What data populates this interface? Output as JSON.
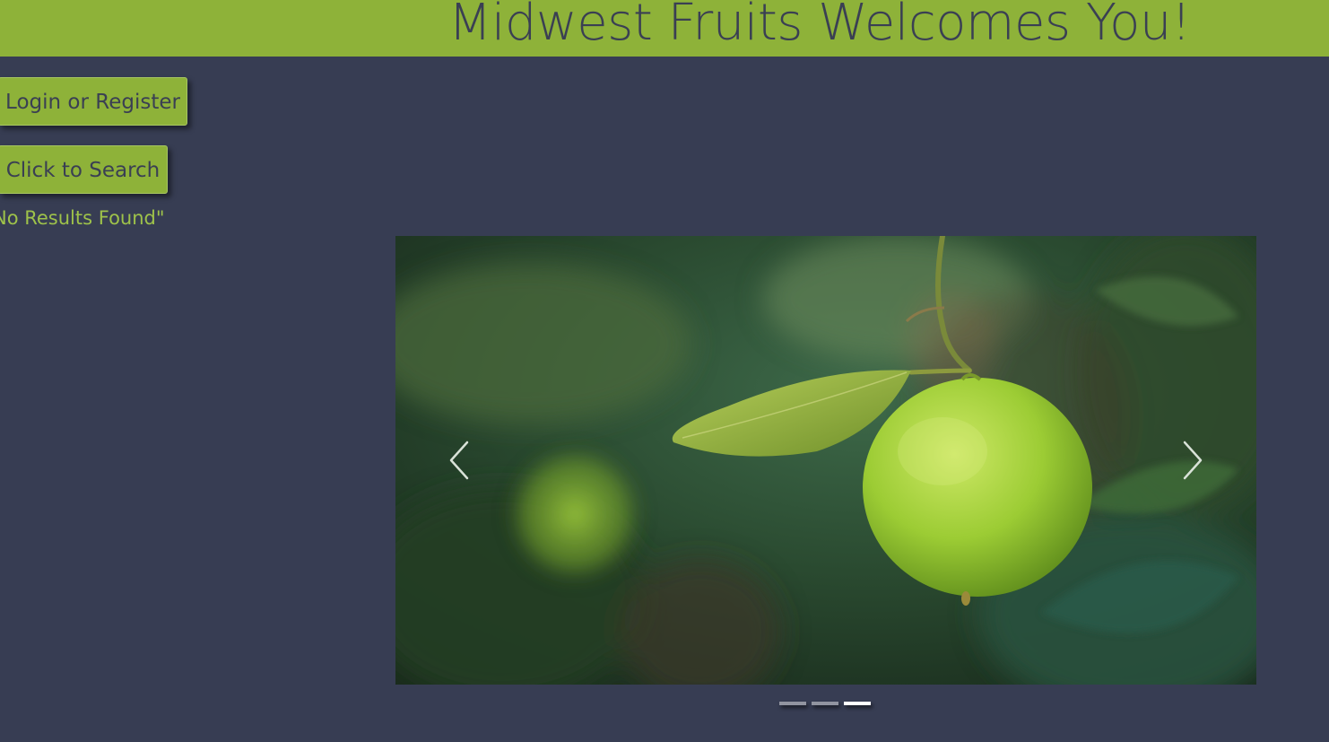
{
  "header": {
    "title": "Midwest Fruits Welcomes You!",
    "background_color": "#8eb239",
    "text_color": "#3a3f53"
  },
  "actions": {
    "login_label": "Login or Register",
    "search_label": "Click to Search"
  },
  "status": {
    "text": "No Results Found\""
  },
  "carousel": {
    "slide_image": "lime-on-tree-photo",
    "prev_icon": "chevron-left-icon",
    "next_icon": "chevron-right-icon",
    "indicators": [
      {
        "active": false
      },
      {
        "active": false
      },
      {
        "active": true
      }
    ]
  },
  "colors": {
    "page_background": "#373d53",
    "accent": "#8eb239",
    "status_text": "#9ec24a"
  }
}
